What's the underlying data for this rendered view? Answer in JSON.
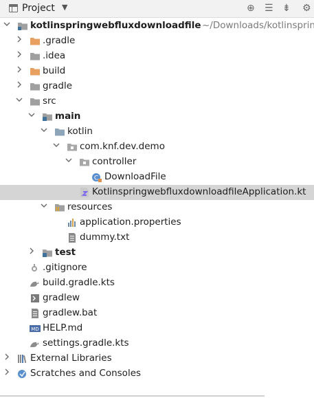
{
  "header": {
    "title": "Project"
  },
  "tree": [
    {
      "label": "kotlinspringwebfluxdownloadfile",
      "path": "~/Downloads/kotlinspring",
      "icon": "module-folder-icon",
      "arrow": "expanded",
      "bold": true
    },
    {
      "label": ".gradle",
      "icon": "orange-folder-icon",
      "arrow": "collapsed"
    },
    {
      "label": ".idea",
      "icon": "gray-folder-icon",
      "arrow": "collapsed"
    },
    {
      "label": "build",
      "icon": "orange-folder-icon",
      "arrow": "collapsed"
    },
    {
      "label": "gradle",
      "icon": "gray-folder-icon",
      "arrow": "collapsed"
    },
    {
      "label": "src",
      "icon": "gray-folder-icon",
      "arrow": "expanded"
    },
    {
      "label": "main",
      "icon": "source-folder-icon",
      "arrow": "expanded",
      "bold": true
    },
    {
      "label": "kotlin",
      "icon": "blue-folder-icon",
      "arrow": "expanded"
    },
    {
      "label": "com.knf.dev.demo",
      "icon": "package-icon",
      "arrow": "expanded"
    },
    {
      "label": "controller",
      "icon": "package-icon",
      "arrow": "expanded"
    },
    {
      "label": "DownloadFile",
      "icon": "kotlin-class-icon",
      "arrow": "none"
    },
    {
      "label": "KotlinspringwebfluxdownloadfileApplication.kt",
      "icon": "kotlin-file-icon",
      "arrow": "none",
      "selected": true
    },
    {
      "label": "resources",
      "icon": "resources-folder-icon",
      "arrow": "expanded"
    },
    {
      "label": "application.properties",
      "icon": "properties-file-icon",
      "arrow": "none"
    },
    {
      "label": "dummy.txt",
      "icon": "text-file-icon",
      "arrow": "none"
    },
    {
      "label": "test",
      "icon": "source-folder-icon",
      "arrow": "collapsed",
      "bold": true
    },
    {
      "label": ".gitignore",
      "icon": "gitignore-icon",
      "arrow": "none"
    },
    {
      "label": "build.gradle.kts",
      "icon": "gradle-icon",
      "arrow": "none"
    },
    {
      "label": "gradlew",
      "icon": "terminal-file-icon",
      "arrow": "none"
    },
    {
      "label": "gradlew.bat",
      "icon": "text-file-icon",
      "arrow": "none"
    },
    {
      "label": "HELP.md",
      "icon": "markdown-icon",
      "arrow": "none"
    },
    {
      "label": "settings.gradle.kts",
      "icon": "gradle-icon",
      "arrow": "none"
    },
    {
      "label": "External Libraries",
      "icon": "libraries-icon",
      "arrow": "collapsed"
    },
    {
      "label": "Scratches and Consoles",
      "icon": "scratches-icon",
      "arrow": "collapsed"
    }
  ]
}
